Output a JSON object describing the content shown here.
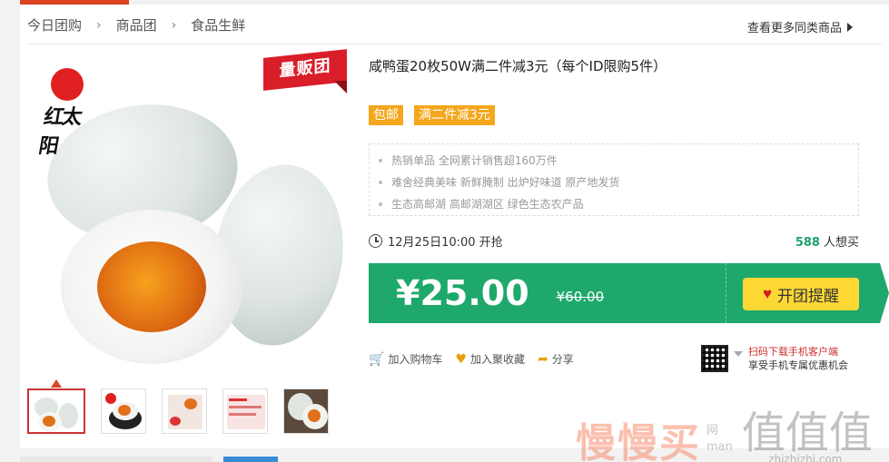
{
  "breadcrumb": [
    "今日团购",
    "商品团",
    "食品生鲜"
  ],
  "more_link": "查看更多同类商品",
  "product": {
    "ribbon": "量贩团",
    "brand": "红太阳",
    "title": "咸鸭蛋20枚50W满二件减3元（每个ID限购5件）",
    "tags": [
      "包邮",
      "满二件减3元"
    ],
    "features": [
      "热销单品 全网累计销售超160万件",
      "难舍经典美味 新鲜腌制 出炉好味道 原产地发货",
      "生态高邮湖 高邮湖湖区 绿色生态农产品"
    ],
    "start_time": "12月25日10:00 开抢",
    "want_count": "588",
    "want_label": "人想买",
    "price": "¥25.00",
    "original_price": "¥60.00",
    "remind_label": "开团提醒"
  },
  "actions": {
    "cart": "加入购物车",
    "favorite": "加入聚收藏",
    "share": "分享"
  },
  "qr": {
    "line1": "扫码下载手机客户端",
    "line2": "享受手机专属优惠机会"
  },
  "watermark": {
    "main": "慢慢买",
    "sub1": "网",
    "sub2": "man",
    "logo": "值值值",
    "url": "zhizhizhi.com"
  },
  "colors": {
    "accent_green": "#1ea86b",
    "tag_orange": "#f4a61c",
    "button_yellow": "#fdd835",
    "want_green": "#1fa16d"
  }
}
